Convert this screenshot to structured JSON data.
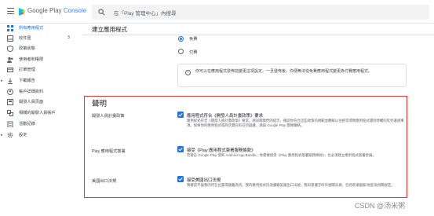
{
  "header": {
    "brand_part1": "Google Play",
    "brand_part2": "Console",
    "search_placeholder": "在「Play 管理中心」內搜尋"
  },
  "sidebar": {
    "items": [
      {
        "label": "所有應用程式",
        "active": true,
        "icon": "grid-icon"
      },
      {
        "label": "收件匣",
        "count": "3",
        "icon": "inbox-icon"
      },
      {
        "label": "政策狀態",
        "icon": "shield-icon"
      },
      {
        "label": "使用者和權限",
        "icon": "users-icon"
      },
      {
        "label": "訂單管理",
        "icon": "card-icon"
      },
      {
        "label": "下載報告",
        "icon": "download-icon"
      },
      {
        "label": "帳戶詳細資料",
        "icon": "account-icon"
      },
      {
        "label": "開發人員頁面",
        "icon": "page-icon"
      },
      {
        "label": "相關的開發人員帳戶",
        "icon": "link-icon"
      },
      {
        "label": "活動記錄",
        "icon": "clipboard-icon"
      },
      {
        "label": "設定",
        "icon": "gear-icon"
      }
    ]
  },
  "page": {
    "title": "建立應用程式",
    "radio_free": "免費",
    "radio_paid": "付費",
    "info_text": "你可以在應用程式發佈前變更這項設定。一旦發佈後，你便無法從免費應用程式變更為付費應用程式。"
  },
  "declarations": {
    "title": "聲明",
    "rows": [
      {
        "label": "開發人員計畫政策",
        "head": "應用程式符合《開發人員計畫政策》要求",
        "desc": "應用程式符合《開發人員計畫政策》要求。請詳閱我們的提示，確認你符合這些政策的規範並瞭解以往經常導致應用程式遭到停權的常見違規事項。如果你的應用程式或商店資訊有任何疑慮，請與 Google Play 團隊聯絡。"
      },
      {
        "label": "Play 應用程式簽署",
        "head": "接受《Play 應用程式簽署服務條款》",
        "desc": "若要在 Google Play 發佈 Android App Bundle，你需要接受《Play 應用程式簽署服務條款》，也必須建立應用程式簽署金鑰。"
      },
      {
        "label": "美國出口法規",
        "head": "接受美國出口法規",
        "desc": "我確認不論我的所在位置或國籍為何，我的應用程式均須遵循美國出口法規；我同意遵守所有相關法規，包括禁運國家/地區及相關規定。"
      }
    ]
  },
  "watermark": "CSDN @汤米粥",
  "colors": {
    "accent": "#1a73e8",
    "highlight_border": "#e53935"
  }
}
